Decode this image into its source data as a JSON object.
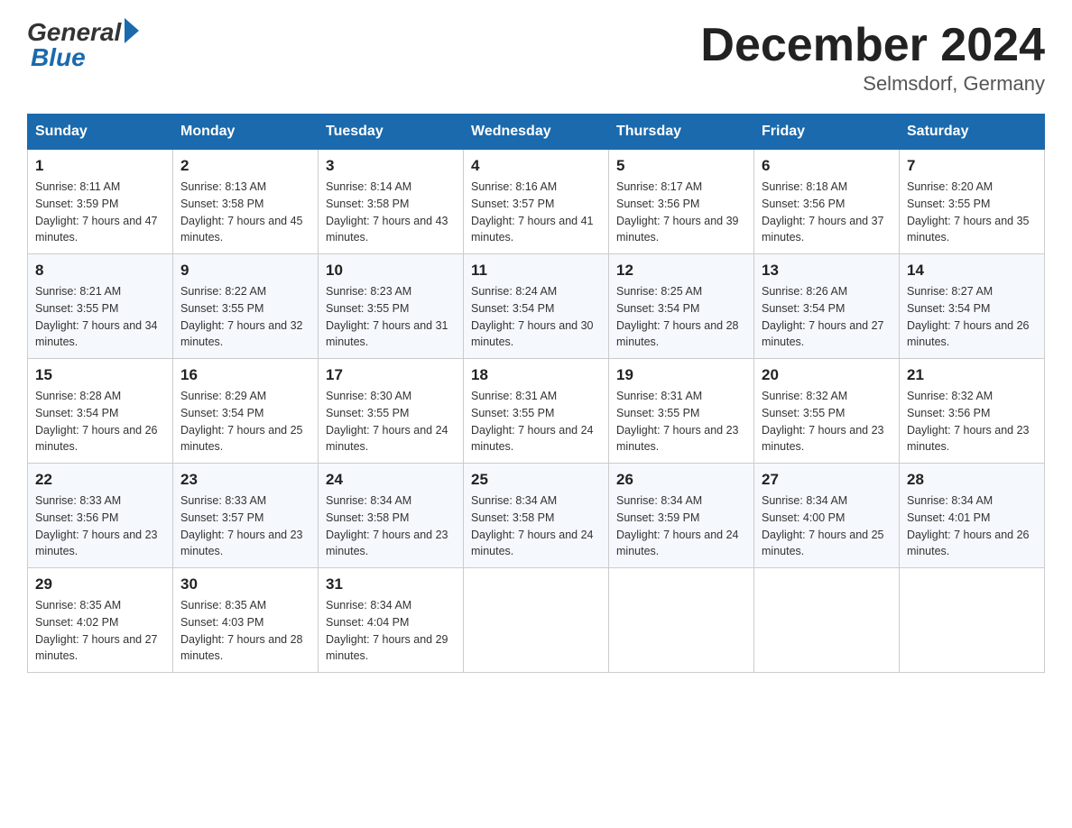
{
  "header": {
    "logo_general": "General",
    "logo_blue": "Blue",
    "month_title": "December 2024",
    "location": "Selmsdorf, Germany"
  },
  "weekdays": [
    "Sunday",
    "Monday",
    "Tuesday",
    "Wednesday",
    "Thursday",
    "Friday",
    "Saturday"
  ],
  "weeks": [
    [
      {
        "day": "1",
        "sunrise": "8:11 AM",
        "sunset": "3:59 PM",
        "daylight": "7 hours and 47 minutes."
      },
      {
        "day": "2",
        "sunrise": "8:13 AM",
        "sunset": "3:58 PM",
        "daylight": "7 hours and 45 minutes."
      },
      {
        "day": "3",
        "sunrise": "8:14 AM",
        "sunset": "3:58 PM",
        "daylight": "7 hours and 43 minutes."
      },
      {
        "day": "4",
        "sunrise": "8:16 AM",
        "sunset": "3:57 PM",
        "daylight": "7 hours and 41 minutes."
      },
      {
        "day": "5",
        "sunrise": "8:17 AM",
        "sunset": "3:56 PM",
        "daylight": "7 hours and 39 minutes."
      },
      {
        "day": "6",
        "sunrise": "8:18 AM",
        "sunset": "3:56 PM",
        "daylight": "7 hours and 37 minutes."
      },
      {
        "day": "7",
        "sunrise": "8:20 AM",
        "sunset": "3:55 PM",
        "daylight": "7 hours and 35 minutes."
      }
    ],
    [
      {
        "day": "8",
        "sunrise": "8:21 AM",
        "sunset": "3:55 PM",
        "daylight": "7 hours and 34 minutes."
      },
      {
        "day": "9",
        "sunrise": "8:22 AM",
        "sunset": "3:55 PM",
        "daylight": "7 hours and 32 minutes."
      },
      {
        "day": "10",
        "sunrise": "8:23 AM",
        "sunset": "3:55 PM",
        "daylight": "7 hours and 31 minutes."
      },
      {
        "day": "11",
        "sunrise": "8:24 AM",
        "sunset": "3:54 PM",
        "daylight": "7 hours and 30 minutes."
      },
      {
        "day": "12",
        "sunrise": "8:25 AM",
        "sunset": "3:54 PM",
        "daylight": "7 hours and 28 minutes."
      },
      {
        "day": "13",
        "sunrise": "8:26 AM",
        "sunset": "3:54 PM",
        "daylight": "7 hours and 27 minutes."
      },
      {
        "day": "14",
        "sunrise": "8:27 AM",
        "sunset": "3:54 PM",
        "daylight": "7 hours and 26 minutes."
      }
    ],
    [
      {
        "day": "15",
        "sunrise": "8:28 AM",
        "sunset": "3:54 PM",
        "daylight": "7 hours and 26 minutes."
      },
      {
        "day": "16",
        "sunrise": "8:29 AM",
        "sunset": "3:54 PM",
        "daylight": "7 hours and 25 minutes."
      },
      {
        "day": "17",
        "sunrise": "8:30 AM",
        "sunset": "3:55 PM",
        "daylight": "7 hours and 24 minutes."
      },
      {
        "day": "18",
        "sunrise": "8:31 AM",
        "sunset": "3:55 PM",
        "daylight": "7 hours and 24 minutes."
      },
      {
        "day": "19",
        "sunrise": "8:31 AM",
        "sunset": "3:55 PM",
        "daylight": "7 hours and 23 minutes."
      },
      {
        "day": "20",
        "sunrise": "8:32 AM",
        "sunset": "3:55 PM",
        "daylight": "7 hours and 23 minutes."
      },
      {
        "day": "21",
        "sunrise": "8:32 AM",
        "sunset": "3:56 PM",
        "daylight": "7 hours and 23 minutes."
      }
    ],
    [
      {
        "day": "22",
        "sunrise": "8:33 AM",
        "sunset": "3:56 PM",
        "daylight": "7 hours and 23 minutes."
      },
      {
        "day": "23",
        "sunrise": "8:33 AM",
        "sunset": "3:57 PM",
        "daylight": "7 hours and 23 minutes."
      },
      {
        "day": "24",
        "sunrise": "8:34 AM",
        "sunset": "3:58 PM",
        "daylight": "7 hours and 23 minutes."
      },
      {
        "day": "25",
        "sunrise": "8:34 AM",
        "sunset": "3:58 PM",
        "daylight": "7 hours and 24 minutes."
      },
      {
        "day": "26",
        "sunrise": "8:34 AM",
        "sunset": "3:59 PM",
        "daylight": "7 hours and 24 minutes."
      },
      {
        "day": "27",
        "sunrise": "8:34 AM",
        "sunset": "4:00 PM",
        "daylight": "7 hours and 25 minutes."
      },
      {
        "day": "28",
        "sunrise": "8:34 AM",
        "sunset": "4:01 PM",
        "daylight": "7 hours and 26 minutes."
      }
    ],
    [
      {
        "day": "29",
        "sunrise": "8:35 AM",
        "sunset": "4:02 PM",
        "daylight": "7 hours and 27 minutes."
      },
      {
        "day": "30",
        "sunrise": "8:35 AM",
        "sunset": "4:03 PM",
        "daylight": "7 hours and 28 minutes."
      },
      {
        "day": "31",
        "sunrise": "8:34 AM",
        "sunset": "4:04 PM",
        "daylight": "7 hours and 29 minutes."
      },
      null,
      null,
      null,
      null
    ]
  ]
}
